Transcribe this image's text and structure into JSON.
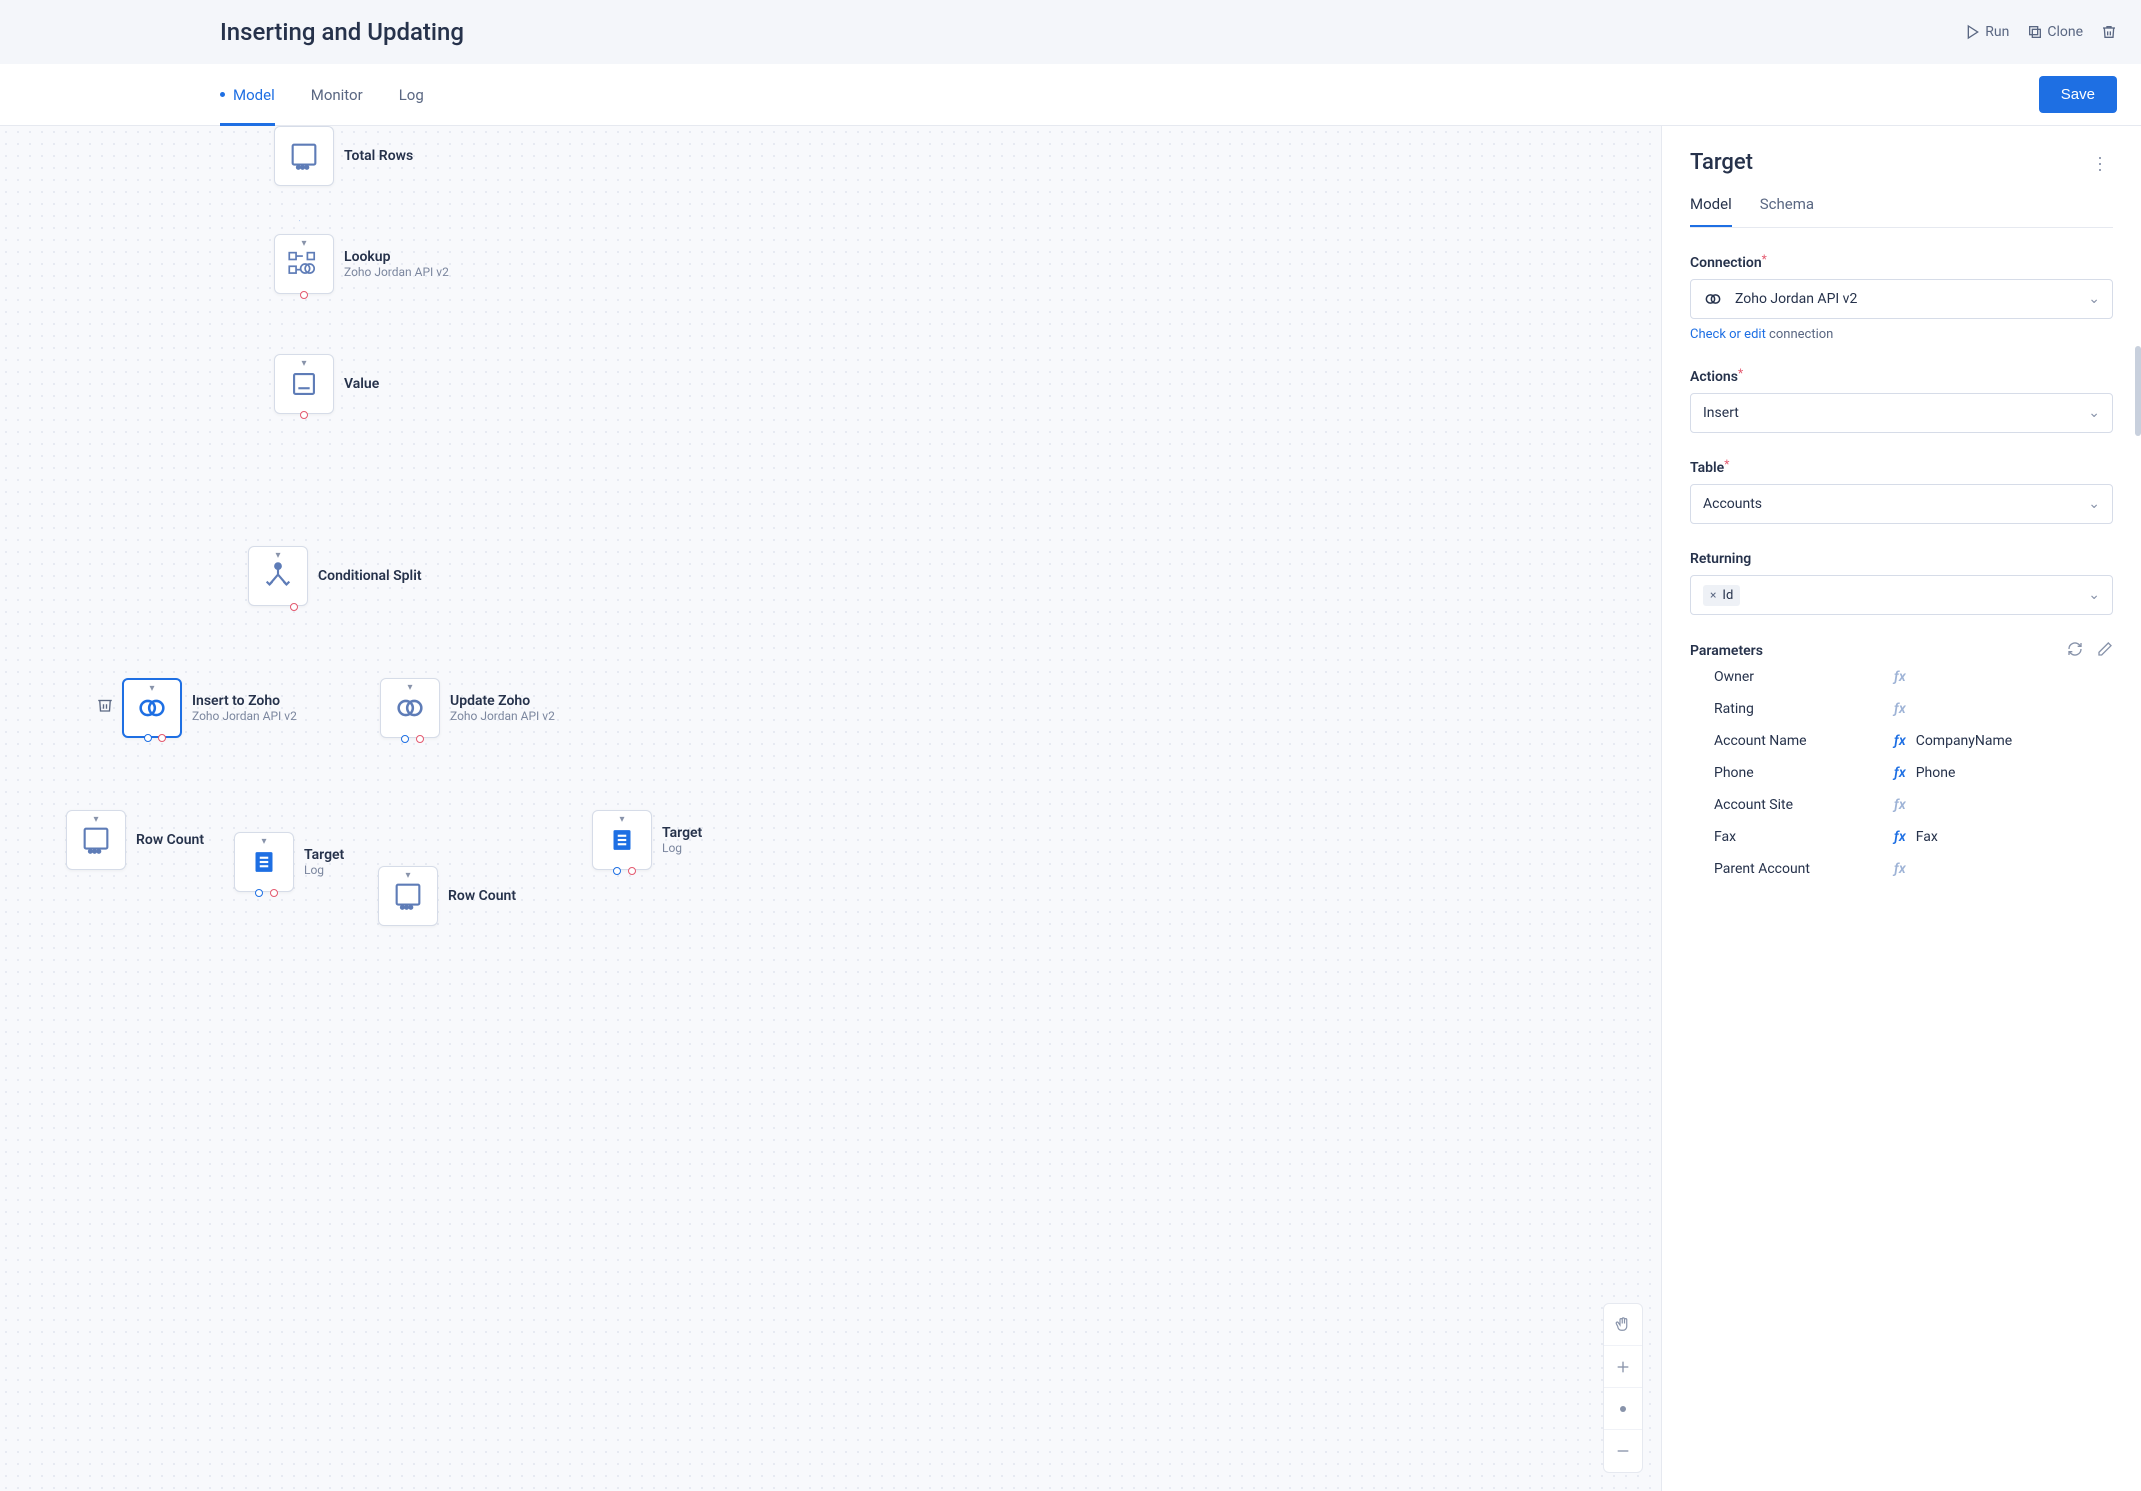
{
  "header": {
    "title": "Inserting and Updating",
    "actions": {
      "run": "Run",
      "clone": "Clone"
    }
  },
  "tabs": {
    "model": "Model",
    "monitor": "Monitor",
    "log": "Log",
    "save": "Save"
  },
  "canvas": {
    "nodes": {
      "totalRows": {
        "title": "Total Rows"
      },
      "lookup": {
        "title": "Lookup",
        "sub": "Zoho Jordan API v2"
      },
      "value": {
        "title": "Value"
      },
      "condSplit": {
        "title": "Conditional Split"
      },
      "insertZoho": {
        "title": "Insert to Zoho",
        "sub": "Zoho Jordan API v2"
      },
      "updateZoho": {
        "title": "Update Zoho",
        "sub": "Zoho Jordan API v2"
      },
      "rowCount1": {
        "title": "Row Count"
      },
      "targetL": {
        "title": "Target",
        "sub": "Log"
      },
      "rowCount2": {
        "title": "Row Count"
      },
      "targetR": {
        "title": "Target",
        "sub": "Log"
      }
    }
  },
  "sidebar": {
    "title": "Target",
    "tabs": {
      "model": "Model",
      "schema": "Schema"
    },
    "connection": {
      "label": "Connection",
      "value": "Zoho Jordan API v2",
      "hint_link": "Check or edit",
      "hint_rest": " connection"
    },
    "actions": {
      "label": "Actions",
      "value": "Insert"
    },
    "table": {
      "label": "Table",
      "value": "Accounts"
    },
    "returning": {
      "label": "Returning",
      "chip": "Id"
    },
    "parameters": {
      "label": "Parameters",
      "rows": [
        {
          "name": "Owner",
          "value": ""
        },
        {
          "name": "Rating",
          "value": ""
        },
        {
          "name": "Account Name",
          "value": "CompanyName"
        },
        {
          "name": "Phone",
          "value": "Phone"
        },
        {
          "name": "Account Site",
          "value": ""
        },
        {
          "name": "Fax",
          "value": "Fax"
        },
        {
          "name": "Parent Account",
          "value": ""
        }
      ]
    }
  }
}
